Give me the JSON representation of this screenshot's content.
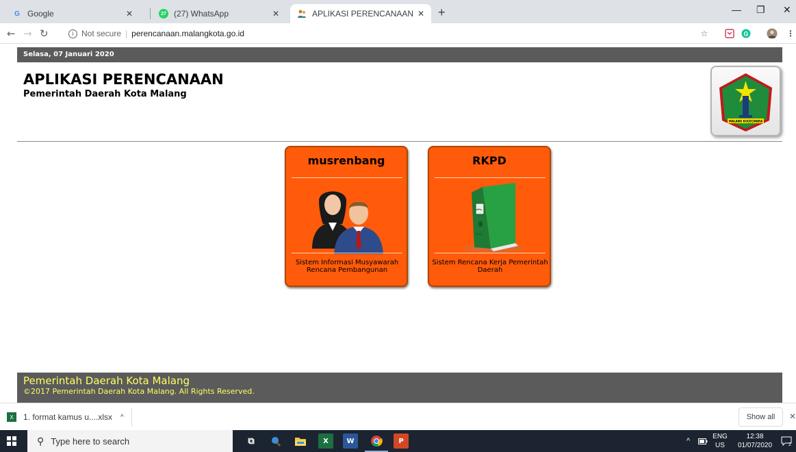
{
  "browser": {
    "tabs": [
      {
        "label": "Google",
        "icon": "google-g-icon"
      },
      {
        "label": "(27) WhatsApp",
        "icon": "whatsapp-icon",
        "badge": "27"
      },
      {
        "label": "APLIKASI PERENCANAAN: Login",
        "icon": "people-icon"
      }
    ],
    "address": {
      "security_text": "Not secure",
      "url": "perencanaan.malangkota.go.id"
    }
  },
  "page": {
    "date": "Selasa, 07 Januari 2020",
    "title": "APLIKASI PERENCANAAN",
    "subtitle": "Pemerintah Daerah Kota Malang",
    "logo_text": "MALANG KUÇEÇWARA",
    "cards": [
      {
        "title": "musrenbang",
        "description": "Sistem Informasi Musyawarah Rencana Pembangunan",
        "image": "users-icon"
      },
      {
        "title": "RKPD",
        "description": "Sistem Rencana Kerja Pemerintah Daerah",
        "image": "binder-icon"
      }
    ],
    "footer": {
      "title": "Pemerintah Daerah Kota Malang",
      "copyright": "©2017 Pemerintah Daerah Kota Malang. All Rights Reserved."
    },
    "colors": {
      "card": "#ff5b0a",
      "bar": "#5b5b5b",
      "footer_text": "#ffff66"
    }
  },
  "downloads": {
    "file": "1. format kamus u....xlsx",
    "show_all": "Show all"
  },
  "taskbar": {
    "search_placeholder": "Type here to search",
    "lang_top": "ENG",
    "lang_bottom": "US",
    "time": "12:38",
    "date": "01/07/2020",
    "notification_count": "2"
  }
}
